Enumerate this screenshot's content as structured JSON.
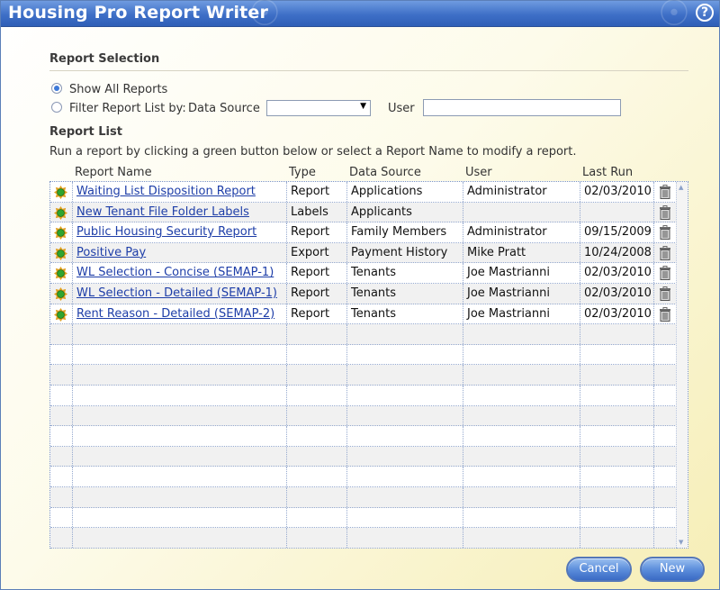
{
  "window": {
    "title": "Housing Pro Report Writer",
    "help_label": "?"
  },
  "selection": {
    "title": "Report Selection",
    "show_all_label": "Show All Reports",
    "filter_label": "Filter Report List by:",
    "data_source_label": "Data Source",
    "data_source_value": "",
    "user_label": "User",
    "user_value": ""
  },
  "report_list": {
    "title": "Report List",
    "instructions": "Run a report by clicking a green button below or select a Report Name to modify a report.",
    "columns": [
      "Report Name",
      "Type",
      "Data Source",
      "User",
      "Last Run"
    ],
    "rows": [
      {
        "name": "Waiting List Disposition Report",
        "type": "Report",
        "source": "Applications",
        "user": "Administrator",
        "last_run": "02/03/2010"
      },
      {
        "name": "New Tenant File Folder Labels",
        "type": "Labels",
        "source": "Applicants",
        "user": "",
        "last_run": ""
      },
      {
        "name": "Public Housing Security Report",
        "type": "Report",
        "source": "Family Members",
        "user": "Administrator",
        "last_run": "09/15/2009"
      },
      {
        "name": "Positive Pay",
        "type": "Export",
        "source": "Payment History",
        "user": "Mike Pratt",
        "last_run": "10/24/2008"
      },
      {
        "name": "WL Selection - Concise (SEMAP-1)",
        "type": "Report",
        "source": "Tenants",
        "user": "Joe Mastrianni",
        "last_run": "02/03/2010"
      },
      {
        "name": "WL Selection - Detailed (SEMAP-1)",
        "type": "Report",
        "source": "Tenants",
        "user": "Joe Mastrianni",
        "last_run": "02/03/2010"
      },
      {
        "name": "Rent Reason - Detailed (SEMAP-2)",
        "type": "Report",
        "source": "Tenants",
        "user": "Joe Mastrianni",
        "last_run": "02/03/2010"
      }
    ],
    "empty_rows": 11
  },
  "buttons": {
    "cancel": "Cancel",
    "new": "New"
  },
  "colors": {
    "title_bar": "#3e6fc7",
    "link": "#1e3ea8",
    "button": "#5d8fdc",
    "run_icon": "#2fa52f"
  }
}
